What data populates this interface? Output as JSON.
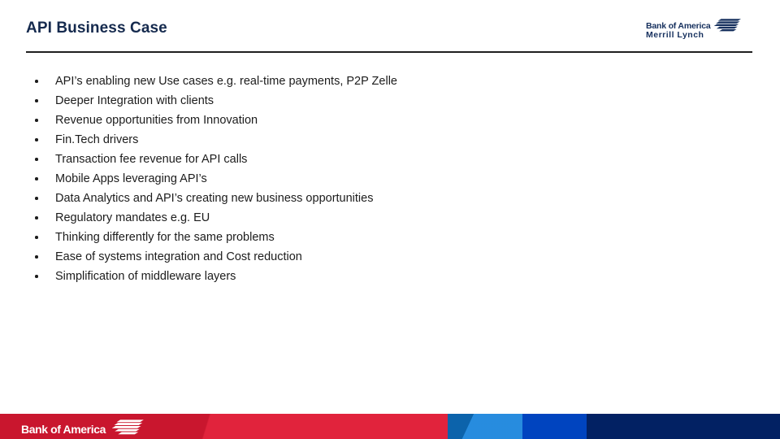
{
  "slide": {
    "title": "API Business Case",
    "bullets": [
      "API’s enabling new Use cases e.g. real-time payments, P2P Zelle",
      "Deeper Integration with clients",
      "Revenue opportunities from Innovation",
      "Fin.Tech drivers",
      "Transaction fee revenue for API calls",
      "Mobile Apps leveraging API’s",
      "Data Analytics and API’s creating new business opportunities",
      "Regulatory mandates e.g. EU",
      "Thinking differently for the same problems",
      "Ease of systems integration and Cost reduction",
      "Simplification of middleware layers"
    ]
  },
  "header_brand": {
    "line1": "Bank of America",
    "line2": "Merrill Lynch",
    "flag_icon": "bank-of-america-flag-icon"
  },
  "footer_brand": {
    "text": "Bank of America",
    "flag_icon": "bank-of-america-flag-icon"
  },
  "colors": {
    "title_navy": "#152a4e",
    "brand_navy": "#16305e",
    "body_text": "#1c1c1c",
    "rule": "#1f1f1f",
    "footer_red": "#e01933",
    "footer_light_blue": "#0f7fdb",
    "footer_blue": "#0044bf",
    "footer_navy": "#022163",
    "background": "#ffffff"
  }
}
